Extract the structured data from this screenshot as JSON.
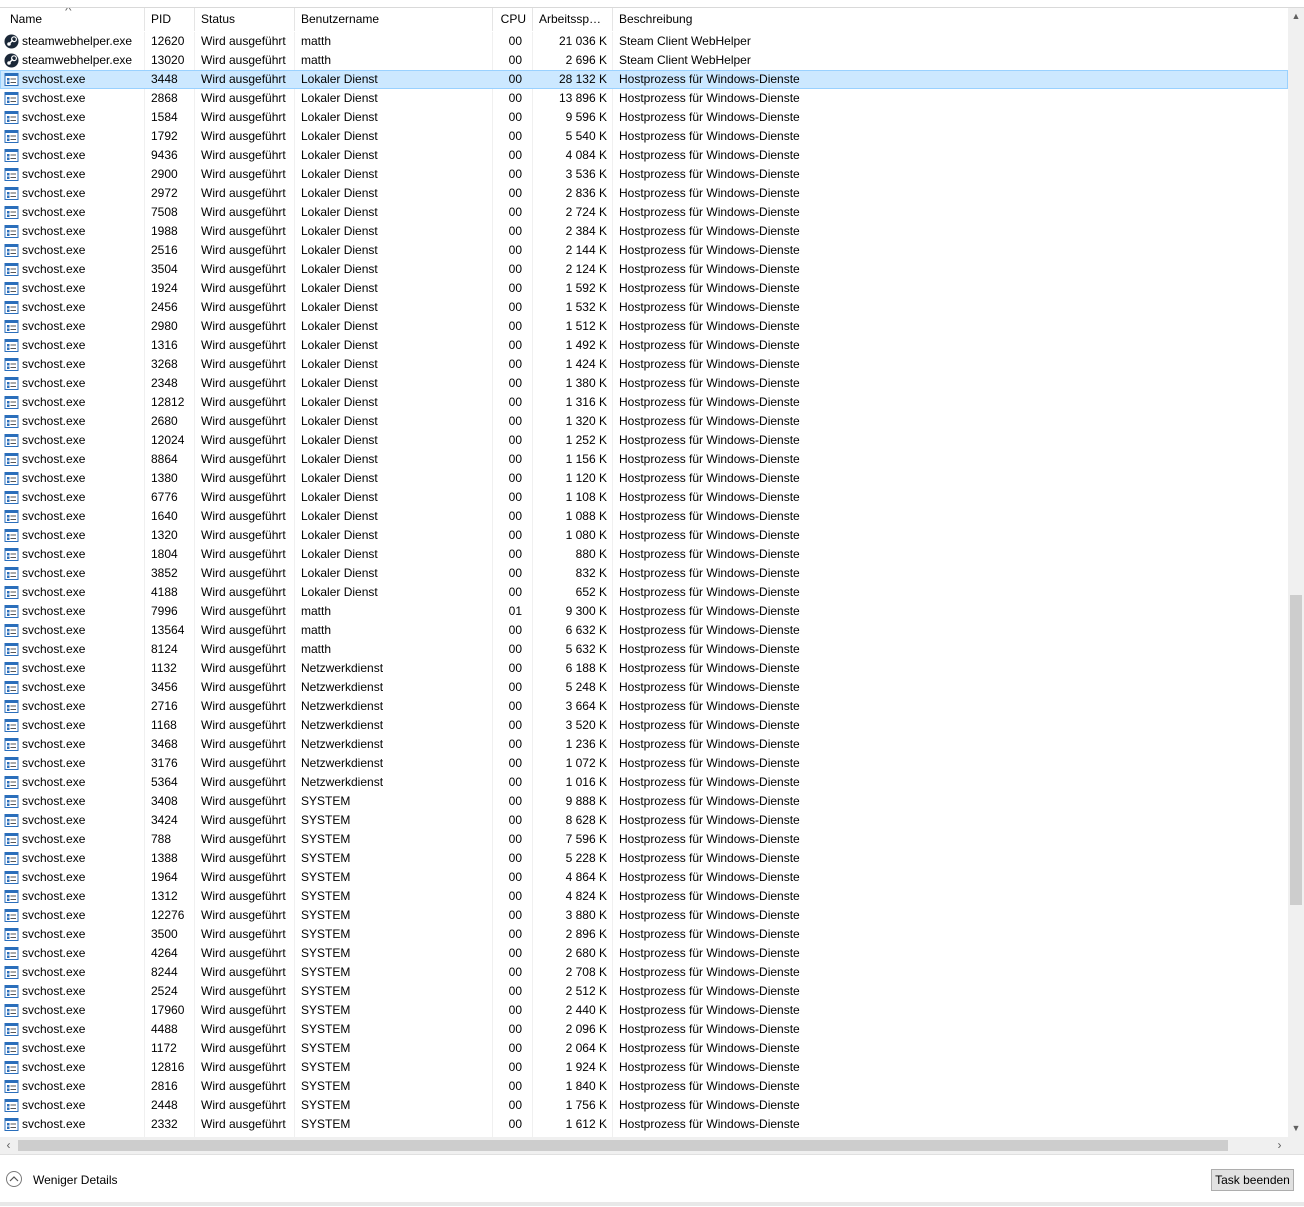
{
  "columns": {
    "name": "Name",
    "pid": "PID",
    "status": "Status",
    "user": "Benutzername",
    "cpu": "CPU",
    "memory": "Arbeitsspei...",
    "description": "Beschreibung"
  },
  "sort_indicator": "^",
  "selected_row_index": 2,
  "rows": [
    {
      "icon": "steam-icon",
      "name": "steamwebhelper.exe",
      "pid": "12620",
      "status": "Wird ausgeführt",
      "user": "matth",
      "cpu": "00",
      "memory": "21 036 K",
      "description": "Steam Client WebHelper"
    },
    {
      "icon": "steam-icon",
      "name": "steamwebhelper.exe",
      "pid": "13020",
      "status": "Wird ausgeführt",
      "user": "matth",
      "cpu": "00",
      "memory": "2 696 K",
      "description": "Steam Client WebHelper"
    },
    {
      "icon": "service-host-icon",
      "name": "svchost.exe",
      "pid": "3448",
      "status": "Wird ausgeführt",
      "user": "Lokaler Dienst",
      "cpu": "00",
      "memory": "28 132 K",
      "description": "Hostprozess für Windows-Dienste"
    },
    {
      "icon": "service-host-icon",
      "name": "svchost.exe",
      "pid": "2868",
      "status": "Wird ausgeführt",
      "user": "Lokaler Dienst",
      "cpu": "00",
      "memory": "13 896 K",
      "description": "Hostprozess für Windows-Dienste"
    },
    {
      "icon": "service-host-icon",
      "name": "svchost.exe",
      "pid": "1584",
      "status": "Wird ausgeführt",
      "user": "Lokaler Dienst",
      "cpu": "00",
      "memory": "9 596 K",
      "description": "Hostprozess für Windows-Dienste"
    },
    {
      "icon": "service-host-icon",
      "name": "svchost.exe",
      "pid": "1792",
      "status": "Wird ausgeführt",
      "user": "Lokaler Dienst",
      "cpu": "00",
      "memory": "5 540 K",
      "description": "Hostprozess für Windows-Dienste"
    },
    {
      "icon": "service-host-icon",
      "name": "svchost.exe",
      "pid": "9436",
      "status": "Wird ausgeführt",
      "user": "Lokaler Dienst",
      "cpu": "00",
      "memory": "4 084 K",
      "description": "Hostprozess für Windows-Dienste"
    },
    {
      "icon": "service-host-icon",
      "name": "svchost.exe",
      "pid": "2900",
      "status": "Wird ausgeführt",
      "user": "Lokaler Dienst",
      "cpu": "00",
      "memory": "3 536 K",
      "description": "Hostprozess für Windows-Dienste"
    },
    {
      "icon": "service-host-icon",
      "name": "svchost.exe",
      "pid": "2972",
      "status": "Wird ausgeführt",
      "user": "Lokaler Dienst",
      "cpu": "00",
      "memory": "2 836 K",
      "description": "Hostprozess für Windows-Dienste"
    },
    {
      "icon": "service-host-icon",
      "name": "svchost.exe",
      "pid": "7508",
      "status": "Wird ausgeführt",
      "user": "Lokaler Dienst",
      "cpu": "00",
      "memory": "2 724 K",
      "description": "Hostprozess für Windows-Dienste"
    },
    {
      "icon": "service-host-icon",
      "name": "svchost.exe",
      "pid": "1988",
      "status": "Wird ausgeführt",
      "user": "Lokaler Dienst",
      "cpu": "00",
      "memory": "2 384 K",
      "description": "Hostprozess für Windows-Dienste"
    },
    {
      "icon": "service-host-icon",
      "name": "svchost.exe",
      "pid": "2516",
      "status": "Wird ausgeführt",
      "user": "Lokaler Dienst",
      "cpu": "00",
      "memory": "2 144 K",
      "description": "Hostprozess für Windows-Dienste"
    },
    {
      "icon": "service-host-icon",
      "name": "svchost.exe",
      "pid": "3504",
      "status": "Wird ausgeführt",
      "user": "Lokaler Dienst",
      "cpu": "00",
      "memory": "2 124 K",
      "description": "Hostprozess für Windows-Dienste"
    },
    {
      "icon": "service-host-icon",
      "name": "svchost.exe",
      "pid": "1924",
      "status": "Wird ausgeführt",
      "user": "Lokaler Dienst",
      "cpu": "00",
      "memory": "1 592 K",
      "description": "Hostprozess für Windows-Dienste"
    },
    {
      "icon": "service-host-icon",
      "name": "svchost.exe",
      "pid": "2456",
      "status": "Wird ausgeführt",
      "user": "Lokaler Dienst",
      "cpu": "00",
      "memory": "1 532 K",
      "description": "Hostprozess für Windows-Dienste"
    },
    {
      "icon": "service-host-icon",
      "name": "svchost.exe",
      "pid": "2980",
      "status": "Wird ausgeführt",
      "user": "Lokaler Dienst",
      "cpu": "00",
      "memory": "1 512 K",
      "description": "Hostprozess für Windows-Dienste"
    },
    {
      "icon": "service-host-icon",
      "name": "svchost.exe",
      "pid": "1316",
      "status": "Wird ausgeführt",
      "user": "Lokaler Dienst",
      "cpu": "00",
      "memory": "1 492 K",
      "description": "Hostprozess für Windows-Dienste"
    },
    {
      "icon": "service-host-icon",
      "name": "svchost.exe",
      "pid": "3268",
      "status": "Wird ausgeführt",
      "user": "Lokaler Dienst",
      "cpu": "00",
      "memory": "1 424 K",
      "description": "Hostprozess für Windows-Dienste"
    },
    {
      "icon": "service-host-icon",
      "name": "svchost.exe",
      "pid": "2348",
      "status": "Wird ausgeführt",
      "user": "Lokaler Dienst",
      "cpu": "00",
      "memory": "1 380 K",
      "description": "Hostprozess für Windows-Dienste"
    },
    {
      "icon": "service-host-icon",
      "name": "svchost.exe",
      "pid": "12812",
      "status": "Wird ausgeführt",
      "user": "Lokaler Dienst",
      "cpu": "00",
      "memory": "1 316 K",
      "description": "Hostprozess für Windows-Dienste"
    },
    {
      "icon": "service-host-icon",
      "name": "svchost.exe",
      "pid": "2680",
      "status": "Wird ausgeführt",
      "user": "Lokaler Dienst",
      "cpu": "00",
      "memory": "1 320 K",
      "description": "Hostprozess für Windows-Dienste"
    },
    {
      "icon": "service-host-icon",
      "name": "svchost.exe",
      "pid": "12024",
      "status": "Wird ausgeführt",
      "user": "Lokaler Dienst",
      "cpu": "00",
      "memory": "1 252 K",
      "description": "Hostprozess für Windows-Dienste"
    },
    {
      "icon": "service-host-icon",
      "name": "svchost.exe",
      "pid": "8864",
      "status": "Wird ausgeführt",
      "user": "Lokaler Dienst",
      "cpu": "00",
      "memory": "1 156 K",
      "description": "Hostprozess für Windows-Dienste"
    },
    {
      "icon": "service-host-icon",
      "name": "svchost.exe",
      "pid": "1380",
      "status": "Wird ausgeführt",
      "user": "Lokaler Dienst",
      "cpu": "00",
      "memory": "1 120 K",
      "description": "Hostprozess für Windows-Dienste"
    },
    {
      "icon": "service-host-icon",
      "name": "svchost.exe",
      "pid": "6776",
      "status": "Wird ausgeführt",
      "user": "Lokaler Dienst",
      "cpu": "00",
      "memory": "1 108 K",
      "description": "Hostprozess für Windows-Dienste"
    },
    {
      "icon": "service-host-icon",
      "name": "svchost.exe",
      "pid": "1640",
      "status": "Wird ausgeführt",
      "user": "Lokaler Dienst",
      "cpu": "00",
      "memory": "1 088 K",
      "description": "Hostprozess für Windows-Dienste"
    },
    {
      "icon": "service-host-icon",
      "name": "svchost.exe",
      "pid": "1320",
      "status": "Wird ausgeführt",
      "user": "Lokaler Dienst",
      "cpu": "00",
      "memory": "1 080 K",
      "description": "Hostprozess für Windows-Dienste"
    },
    {
      "icon": "service-host-icon",
      "name": "svchost.exe",
      "pid": "1804",
      "status": "Wird ausgeführt",
      "user": "Lokaler Dienst",
      "cpu": "00",
      "memory": "880 K",
      "description": "Hostprozess für Windows-Dienste"
    },
    {
      "icon": "service-host-icon",
      "name": "svchost.exe",
      "pid": "3852",
      "status": "Wird ausgeführt",
      "user": "Lokaler Dienst",
      "cpu": "00",
      "memory": "832 K",
      "description": "Hostprozess für Windows-Dienste"
    },
    {
      "icon": "service-host-icon",
      "name": "svchost.exe",
      "pid": "4188",
      "status": "Wird ausgeführt",
      "user": "Lokaler Dienst",
      "cpu": "00",
      "memory": "652 K",
      "description": "Hostprozess für Windows-Dienste"
    },
    {
      "icon": "service-host-icon",
      "name": "svchost.exe",
      "pid": "7996",
      "status": "Wird ausgeführt",
      "user": "matth",
      "cpu": "01",
      "memory": "9 300 K",
      "description": "Hostprozess für Windows-Dienste"
    },
    {
      "icon": "service-host-icon",
      "name": "svchost.exe",
      "pid": "13564",
      "status": "Wird ausgeführt",
      "user": "matth",
      "cpu": "00",
      "memory": "6 632 K",
      "description": "Hostprozess für Windows-Dienste"
    },
    {
      "icon": "service-host-icon",
      "name": "svchost.exe",
      "pid": "8124",
      "status": "Wird ausgeführt",
      "user": "matth",
      "cpu": "00",
      "memory": "5 632 K",
      "description": "Hostprozess für Windows-Dienste"
    },
    {
      "icon": "service-host-icon",
      "name": "svchost.exe",
      "pid": "1132",
      "status": "Wird ausgeführt",
      "user": "Netzwerkdienst",
      "cpu": "00",
      "memory": "6 188 K",
      "description": "Hostprozess für Windows-Dienste"
    },
    {
      "icon": "service-host-icon",
      "name": "svchost.exe",
      "pid": "3456",
      "status": "Wird ausgeführt",
      "user": "Netzwerkdienst",
      "cpu": "00",
      "memory": "5 248 K",
      "description": "Hostprozess für Windows-Dienste"
    },
    {
      "icon": "service-host-icon",
      "name": "svchost.exe",
      "pid": "2716",
      "status": "Wird ausgeführt",
      "user": "Netzwerkdienst",
      "cpu": "00",
      "memory": "3 664 K",
      "description": "Hostprozess für Windows-Dienste"
    },
    {
      "icon": "service-host-icon",
      "name": "svchost.exe",
      "pid": "1168",
      "status": "Wird ausgeführt",
      "user": "Netzwerkdienst",
      "cpu": "00",
      "memory": "3 520 K",
      "description": "Hostprozess für Windows-Dienste"
    },
    {
      "icon": "service-host-icon",
      "name": "svchost.exe",
      "pid": "3468",
      "status": "Wird ausgeführt",
      "user": "Netzwerkdienst",
      "cpu": "00",
      "memory": "1 236 K",
      "description": "Hostprozess für Windows-Dienste"
    },
    {
      "icon": "service-host-icon",
      "name": "svchost.exe",
      "pid": "3176",
      "status": "Wird ausgeführt",
      "user": "Netzwerkdienst",
      "cpu": "00",
      "memory": "1 072 K",
      "description": "Hostprozess für Windows-Dienste"
    },
    {
      "icon": "service-host-icon",
      "name": "svchost.exe",
      "pid": "5364",
      "status": "Wird ausgeführt",
      "user": "Netzwerkdienst",
      "cpu": "00",
      "memory": "1 016 K",
      "description": "Hostprozess für Windows-Dienste"
    },
    {
      "icon": "service-host-icon",
      "name": "svchost.exe",
      "pid": "3408",
      "status": "Wird ausgeführt",
      "user": "SYSTEM",
      "cpu": "00",
      "memory": "9 888 K",
      "description": "Hostprozess für Windows-Dienste"
    },
    {
      "icon": "service-host-icon",
      "name": "svchost.exe",
      "pid": "3424",
      "status": "Wird ausgeführt",
      "user": "SYSTEM",
      "cpu": "00",
      "memory": "8 628 K",
      "description": "Hostprozess für Windows-Dienste"
    },
    {
      "icon": "service-host-icon",
      "name": "svchost.exe",
      "pid": "788",
      "status": "Wird ausgeführt",
      "user": "SYSTEM",
      "cpu": "00",
      "memory": "7 596 K",
      "description": "Hostprozess für Windows-Dienste"
    },
    {
      "icon": "service-host-icon",
      "name": "svchost.exe",
      "pid": "1388",
      "status": "Wird ausgeführt",
      "user": "SYSTEM",
      "cpu": "00",
      "memory": "5 228 K",
      "description": "Hostprozess für Windows-Dienste"
    },
    {
      "icon": "service-host-icon",
      "name": "svchost.exe",
      "pid": "1964",
      "status": "Wird ausgeführt",
      "user": "SYSTEM",
      "cpu": "00",
      "memory": "4 864 K",
      "description": "Hostprozess für Windows-Dienste"
    },
    {
      "icon": "service-host-icon",
      "name": "svchost.exe",
      "pid": "1312",
      "status": "Wird ausgeführt",
      "user": "SYSTEM",
      "cpu": "00",
      "memory": "4 824 K",
      "description": "Hostprozess für Windows-Dienste"
    },
    {
      "icon": "service-host-icon",
      "name": "svchost.exe",
      "pid": "12276",
      "status": "Wird ausgeführt",
      "user": "SYSTEM",
      "cpu": "00",
      "memory": "3 880 K",
      "description": "Hostprozess für Windows-Dienste"
    },
    {
      "icon": "service-host-icon",
      "name": "svchost.exe",
      "pid": "3500",
      "status": "Wird ausgeführt",
      "user": "SYSTEM",
      "cpu": "00",
      "memory": "2 896 K",
      "description": "Hostprozess für Windows-Dienste"
    },
    {
      "icon": "service-host-icon",
      "name": "svchost.exe",
      "pid": "4264",
      "status": "Wird ausgeführt",
      "user": "SYSTEM",
      "cpu": "00",
      "memory": "2 680 K",
      "description": "Hostprozess für Windows-Dienste"
    },
    {
      "icon": "service-host-icon",
      "name": "svchost.exe",
      "pid": "8244",
      "status": "Wird ausgeführt",
      "user": "SYSTEM",
      "cpu": "00",
      "memory": "2 708 K",
      "description": "Hostprozess für Windows-Dienste"
    },
    {
      "icon": "service-host-icon",
      "name": "svchost.exe",
      "pid": "2524",
      "status": "Wird ausgeführt",
      "user": "SYSTEM",
      "cpu": "00",
      "memory": "2 512 K",
      "description": "Hostprozess für Windows-Dienste"
    },
    {
      "icon": "service-host-icon",
      "name": "svchost.exe",
      "pid": "17960",
      "status": "Wird ausgeführt",
      "user": "SYSTEM",
      "cpu": "00",
      "memory": "2 440 K",
      "description": "Hostprozess für Windows-Dienste"
    },
    {
      "icon": "service-host-icon",
      "name": "svchost.exe",
      "pid": "4488",
      "status": "Wird ausgeführt",
      "user": "SYSTEM",
      "cpu": "00",
      "memory": "2 096 K",
      "description": "Hostprozess für Windows-Dienste"
    },
    {
      "icon": "service-host-icon",
      "name": "svchost.exe",
      "pid": "1172",
      "status": "Wird ausgeführt",
      "user": "SYSTEM",
      "cpu": "00",
      "memory": "2 064 K",
      "description": "Hostprozess für Windows-Dienste"
    },
    {
      "icon": "service-host-icon",
      "name": "svchost.exe",
      "pid": "12816",
      "status": "Wird ausgeführt",
      "user": "SYSTEM",
      "cpu": "00",
      "memory": "1 924 K",
      "description": "Hostprozess für Windows-Dienste"
    },
    {
      "icon": "service-host-icon",
      "name": "svchost.exe",
      "pid": "2816",
      "status": "Wird ausgeführt",
      "user": "SYSTEM",
      "cpu": "00",
      "memory": "1 840 K",
      "description": "Hostprozess für Windows-Dienste"
    },
    {
      "icon": "service-host-icon",
      "name": "svchost.exe",
      "pid": "2448",
      "status": "Wird ausgeführt",
      "user": "SYSTEM",
      "cpu": "00",
      "memory": "1 756 K",
      "description": "Hostprozess für Windows-Dienste"
    },
    {
      "icon": "service-host-icon",
      "name": "svchost.exe",
      "pid": "2332",
      "status": "Wird ausgeführt",
      "user": "SYSTEM",
      "cpu": "00",
      "memory": "1 612 K",
      "description": "Hostprozess für Windows-Dienste"
    }
  ],
  "footer": {
    "fewer_details_label": "Weniger Details",
    "end_task_label": "Task beenden"
  },
  "colors": {
    "selected_row_bg": "#cce8ff",
    "selected_row_border": "#99d1ff",
    "button_bg": "#e1e1e1"
  }
}
